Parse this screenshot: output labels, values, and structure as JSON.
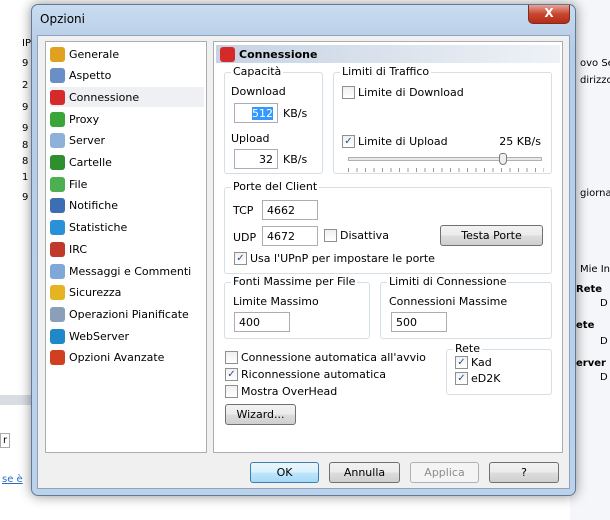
{
  "background": {
    "left_rows": [
      "IP",
      "9",
      "2",
      "9",
      "9",
      "8",
      "8",
      "1",
      "9"
    ],
    "left_tab": "r",
    "left_link": "se è",
    "right_texts": [
      "ovo Se",
      "dirizzo",
      "giorna",
      "Mie Inf",
      "Rete",
      "D",
      "ete",
      "D",
      "erver",
      "D"
    ]
  },
  "dialog": {
    "title": "Opzioni",
    "close_label": "X"
  },
  "sidebar": {
    "items": [
      {
        "label": "Generale",
        "icon": "gear-icon",
        "color": "#e0a020"
      },
      {
        "label": "Aspetto",
        "icon": "monitor-icon",
        "color": "#6a8fc7"
      },
      {
        "label": "Connessione",
        "icon": "plug-icon",
        "color": "#d42a2a",
        "selected": true
      },
      {
        "label": "Proxy",
        "icon": "proxy-icon",
        "color": "#3aa63a"
      },
      {
        "label": "Server",
        "icon": "server-icon",
        "color": "#8fb0d8"
      },
      {
        "label": "Cartelle",
        "icon": "folder-icon",
        "color": "#2f8f2f"
      },
      {
        "label": "File",
        "icon": "file-icon",
        "color": "#4caf50"
      },
      {
        "label": "Notifiche",
        "icon": "notification-icon",
        "color": "#3c6eb4"
      },
      {
        "label": "Statistiche",
        "icon": "statistics-icon",
        "color": "#2a90d8"
      },
      {
        "label": "IRC",
        "icon": "irc-icon",
        "color": "#c0392b"
      },
      {
        "label": "Messaggi e Commenti",
        "icon": "messages-icon",
        "color": "#7fa8d8"
      },
      {
        "label": "Sicurezza",
        "icon": "lock-icon",
        "color": "#e6b422"
      },
      {
        "label": "Operazioni Pianificate",
        "icon": "calendar-icon",
        "color": "#8aa0b8"
      },
      {
        "label": "WebServer",
        "icon": "globe-icon",
        "color": "#1e88c8"
      },
      {
        "label": "Opzioni Avanzate",
        "icon": "advanced-icon",
        "color": "#d04020"
      }
    ]
  },
  "panel": {
    "title": "Connessione",
    "capacity": {
      "legend": "Capacità",
      "download_label": "Download",
      "download_value": "512",
      "upload_label": "Upload",
      "upload_value": "32",
      "unit": "KB/s"
    },
    "traffic": {
      "legend": "Limiti di Traffico",
      "download_limit_label": "Limite di Download",
      "download_limit_checked": false,
      "upload_limit_label": "Limite di Upload",
      "upload_limit_checked": true,
      "upload_limit_value": "25 KB/s",
      "slider_fraction": 0.8
    },
    "ports": {
      "legend": "Porte del Client",
      "tcp_label": "TCP",
      "tcp_value": "4662",
      "udp_label": "UDP",
      "udp_value": "4672",
      "disable_label": "Disattiva",
      "disable_checked": false,
      "test_button": "Testa Porte",
      "upnp_label": "Usa l'UPnP per impostare le porte",
      "upnp_checked": true
    },
    "sources": {
      "legend": "Fonti Massime per File",
      "label": "Limite Massimo",
      "value": "400"
    },
    "conn_limits": {
      "legend": "Limiti di Connessione",
      "label": "Connessioni Massime",
      "value": "500"
    },
    "options": [
      {
        "label": "Connessione automatica all'avvio",
        "checked": false
      },
      {
        "label": "Riconnessione automatica",
        "checked": true
      },
      {
        "label": "Mostra OverHead",
        "checked": false
      }
    ],
    "network": {
      "legend": "Rete",
      "kad_label": "Kad",
      "kad_checked": true,
      "ed2k_label": "eD2K",
      "ed2k_checked": true
    },
    "wizard_button": "Wizard..."
  },
  "buttons": {
    "ok": "OK",
    "cancel": "Annulla",
    "apply": "Applica",
    "help": "?"
  }
}
